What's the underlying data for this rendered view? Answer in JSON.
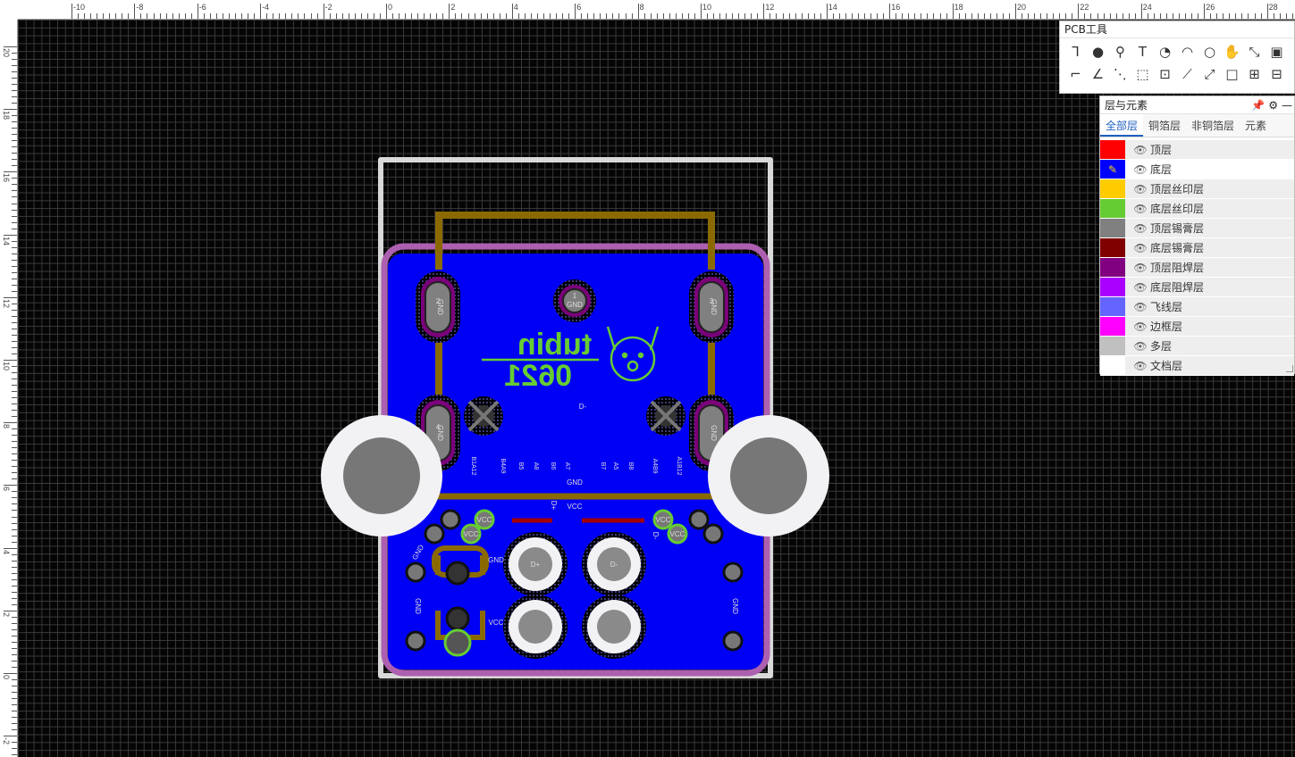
{
  "ruler": {
    "top_labels": [
      "-10",
      "-8",
      "-6",
      "-4",
      "-2",
      "0",
      "2",
      "4",
      "6",
      "8",
      "10",
      "12",
      "14",
      "16",
      "18",
      "20",
      "22",
      "24",
      "26",
      "28"
    ],
    "left_labels": [
      "20",
      "18",
      "16",
      "14",
      "12",
      "10",
      "8",
      "6",
      "4",
      "2",
      "0",
      "-2"
    ]
  },
  "pcb_tools": {
    "title": "PCB工具",
    "tools": [
      "wire-icon",
      "via-icon",
      "pad-icon",
      "text-icon",
      "arc-center-icon",
      "arc-icon",
      "circle-icon",
      "pan-hand-icon",
      "fit-icon",
      "image-icon",
      "corner-track-icon",
      "angle-icon",
      "connect-icon",
      "select-box-icon",
      "region-icon",
      "polygon-icon",
      "route-icon",
      "rectangle-icon",
      "copper-pour-icon",
      "board-outline-icon"
    ]
  },
  "layers_panel": {
    "title": "层与元素",
    "tabs": [
      "全部层",
      "铜箔层",
      "非铜箔层",
      "元素"
    ],
    "active_tab": 0,
    "layers": [
      {
        "name": "顶层",
        "color": "#FF0000",
        "current": false
      },
      {
        "name": "底层",
        "color": "#0000FF",
        "current": true
      },
      {
        "name": "顶层丝印层",
        "color": "#FFCC00",
        "current": false
      },
      {
        "name": "底层丝印层",
        "color": "#66CC33",
        "current": false
      },
      {
        "name": "顶层锡膏层",
        "color": "#808080",
        "current": false
      },
      {
        "name": "底层锡膏层",
        "color": "#800000",
        "current": false
      },
      {
        "name": "顶层阻焊层",
        "color": "#800080",
        "current": false
      },
      {
        "name": "底层阻焊层",
        "color": "#AA00FF",
        "current": false
      },
      {
        "name": "飞线层",
        "color": "#6464FF",
        "current": false
      },
      {
        "name": "边框层",
        "color": "#FF00FF",
        "current": false
      },
      {
        "name": "多层",
        "color": "#C0C0C0",
        "current": false
      },
      {
        "name": "文档层",
        "color": "#FFFFFF",
        "current": false
      }
    ]
  },
  "pcb": {
    "logo_line1": "tubin",
    "logo_line2": "0621",
    "pad_labels": [
      "GND",
      "GND",
      "GND",
      "GND",
      "GND",
      "VCC",
      "VCC",
      "VCC",
      "VCC",
      "D+",
      "D-",
      "1",
      "2",
      "3",
      "4"
    ],
    "silkscreen_pins": [
      "B1A12",
      "B4A9",
      "B5",
      "A8",
      "B6",
      "A7",
      "B7",
      "A5",
      "B8",
      "A4B9",
      "A1B12"
    ],
    "net_labels": [
      "D-",
      "GND",
      "VCC",
      "D+",
      "D-",
      "GND",
      "VCC",
      "GND",
      "GND",
      "GND"
    ]
  }
}
